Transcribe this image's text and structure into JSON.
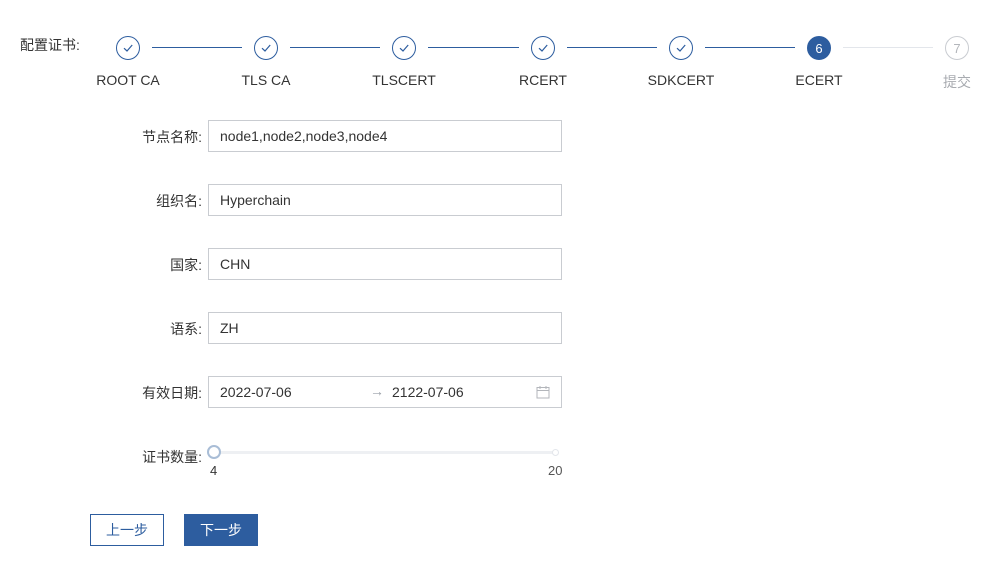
{
  "steps_label": "配置证书:",
  "steps": [
    {
      "title": "ROOT CA",
      "status": "done"
    },
    {
      "title": "TLS CA",
      "status": "done"
    },
    {
      "title": "TLSCERT",
      "status": "done"
    },
    {
      "title": "RCERT",
      "status": "done"
    },
    {
      "title": "SDKCERT",
      "status": "done"
    },
    {
      "title": "ECERT",
      "status": "active",
      "number": "6"
    },
    {
      "title": "提交",
      "status": "pending",
      "number": "7"
    }
  ],
  "form": {
    "node_name": {
      "label": "节点名称:",
      "value": "node1,node2,node3,node4"
    },
    "org_name": {
      "label": "组织名:",
      "value": "Hyperchain"
    },
    "country": {
      "label": "国家:",
      "value": "CHN"
    },
    "language": {
      "label": "语系:",
      "value": "ZH"
    },
    "valid_date": {
      "label": "有效日期:",
      "start": "2022-07-06",
      "separator": "→",
      "end": "2122-07-06"
    },
    "cert_count": {
      "label": "证书数量:",
      "min": "4",
      "max": "20",
      "value": 4
    }
  },
  "buttons": {
    "prev": "上一步",
    "next": "下一步"
  },
  "colors": {
    "accent": "#2d5d9f",
    "border": "#c9ccd1",
    "pending": "#c9ccd1"
  }
}
